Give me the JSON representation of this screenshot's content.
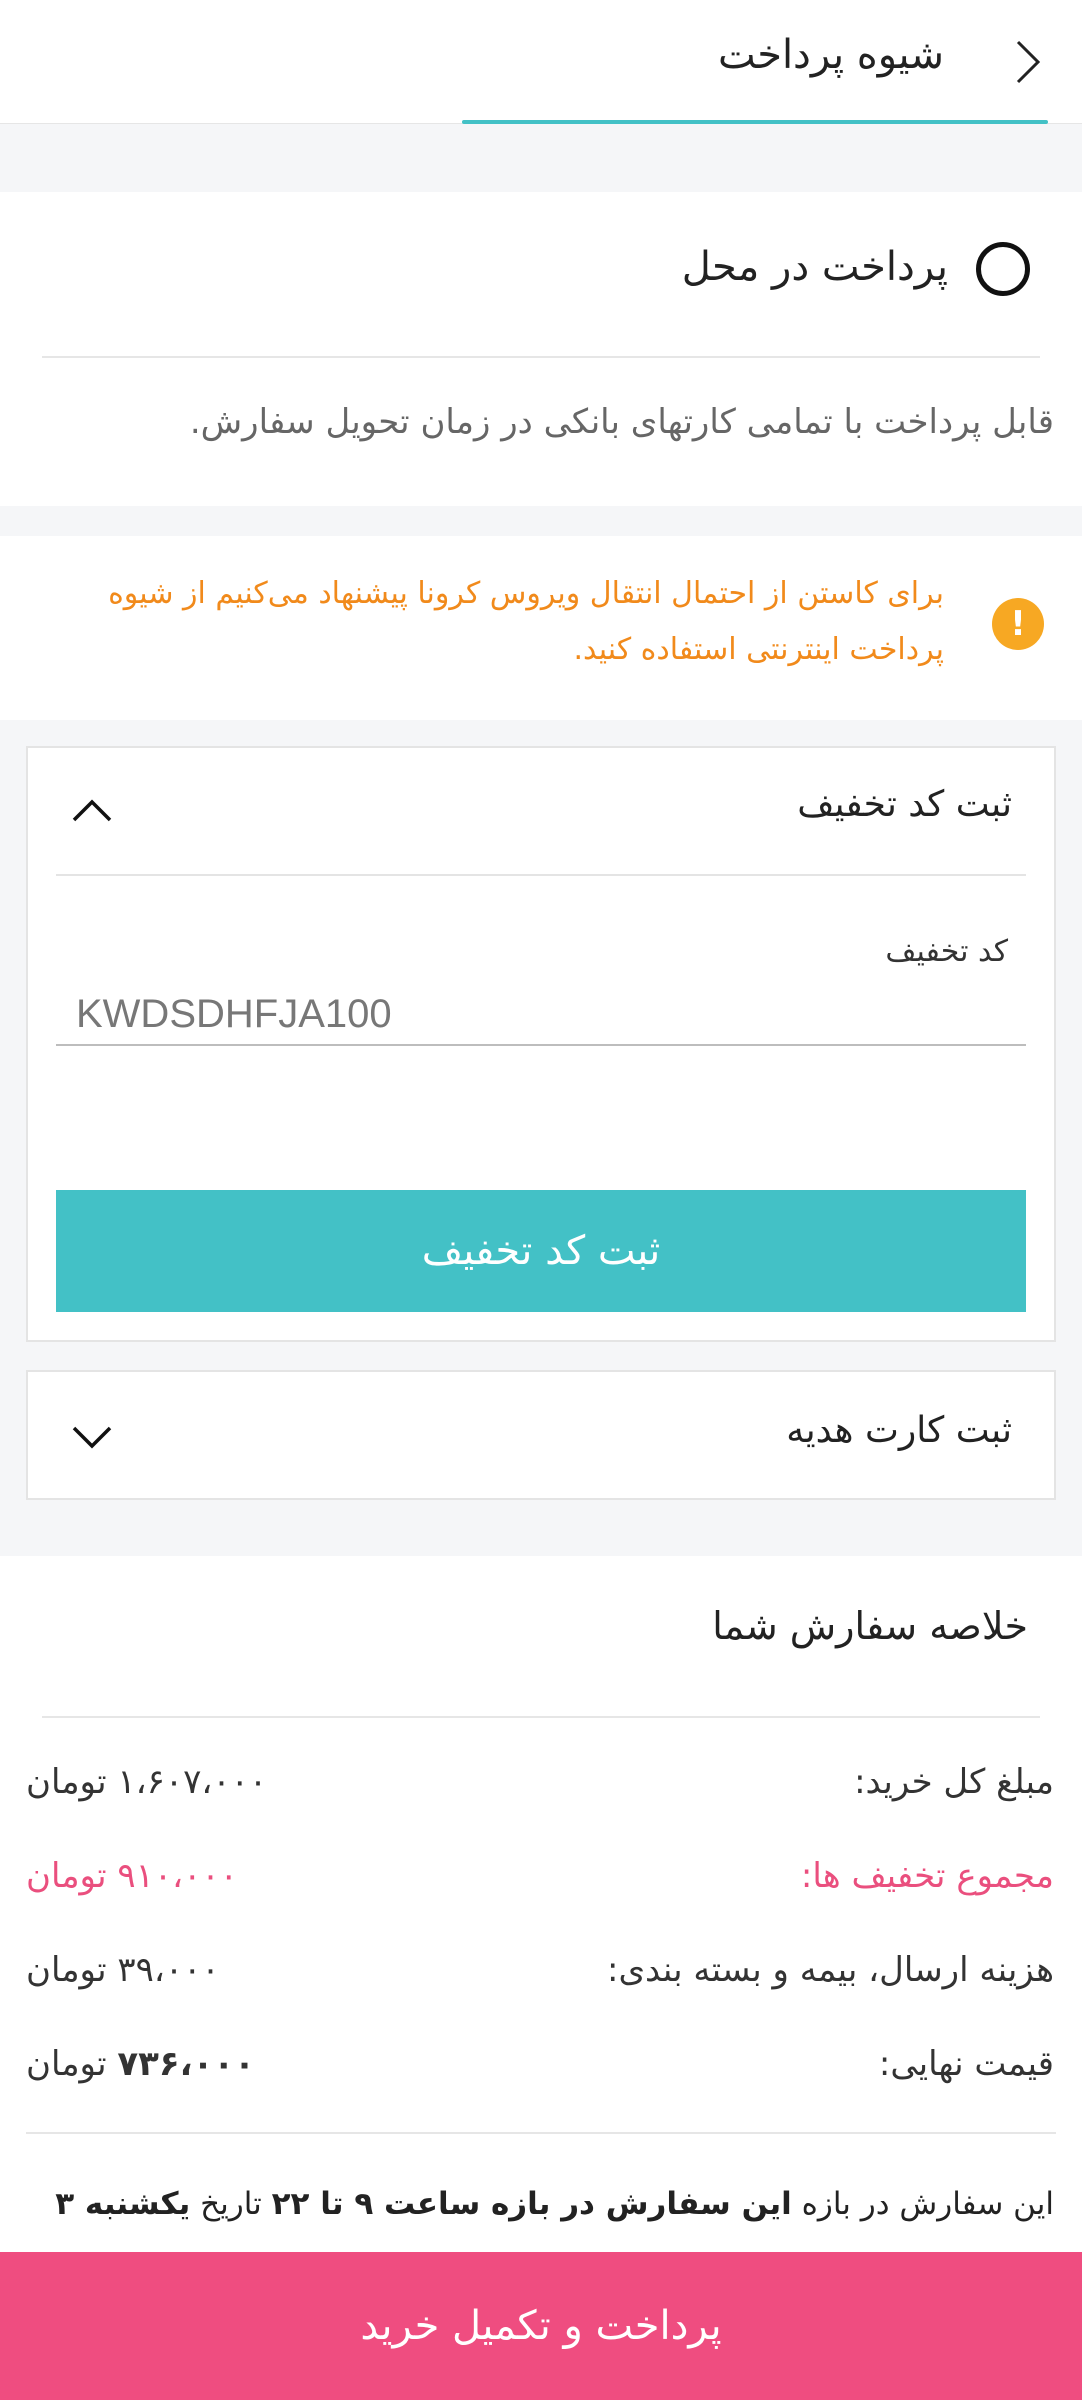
{
  "header": {
    "title": "شیوه پرداخت",
    "back_icon": "chevron-right-icon"
  },
  "payment_option": {
    "label": "پرداخت در محل",
    "selected": false,
    "description": "قابل پرداخت با تمامی کارتهای بانکی در زمان تحویل سفارش."
  },
  "warning": {
    "icon": "warning-icon",
    "color": "#f18a1b",
    "line1": "برای کاستن از احتمال انتقال ویروس کرونا پیشنهاد می‌کنیم از شیوه",
    "line2": "پرداخت اینترنتی استفاده کنید."
  },
  "discount": {
    "title": "ثبت کد تخفیف",
    "field_label": "کد تخفیف",
    "code_value": "KWDSDHFJA100",
    "submit_label": "ثبت کد تخفیف",
    "accent": "#43c1c6"
  },
  "gift_card": {
    "title": "ثبت کارت هدیه"
  },
  "summary": {
    "title": "خلاصه سفارش شما",
    "rows": [
      {
        "label": "مبلغ کل خرید:",
        "value": "۱،۶۰۷،۰۰۰",
        "unit": "تومان"
      },
      {
        "label": "مجموع تخفیف ها:",
        "value": "۹۱۰،۰۰۰",
        "unit": "تومان"
      },
      {
        "label": "هزینه ارسال، بیمه و بسته بندی:",
        "value": "۳۹،۰۰۰",
        "unit": "تومان"
      },
      {
        "label": "قیمت نهایی:",
        "value": "۷۳۶،۰۰۰",
        "unit": "تومان"
      }
    ],
    "note_pre": "این سفارش در بازه ",
    "note_bold1": "این سفارش در بازه ساعت ۹ تا ۲۲",
    "note_mid": " تاریخ ",
    "note_bold2": "یکشنبه ۳"
  },
  "cta": {
    "label": "پرداخت و تکمیل خرید",
    "color": "#ef4d80"
  }
}
